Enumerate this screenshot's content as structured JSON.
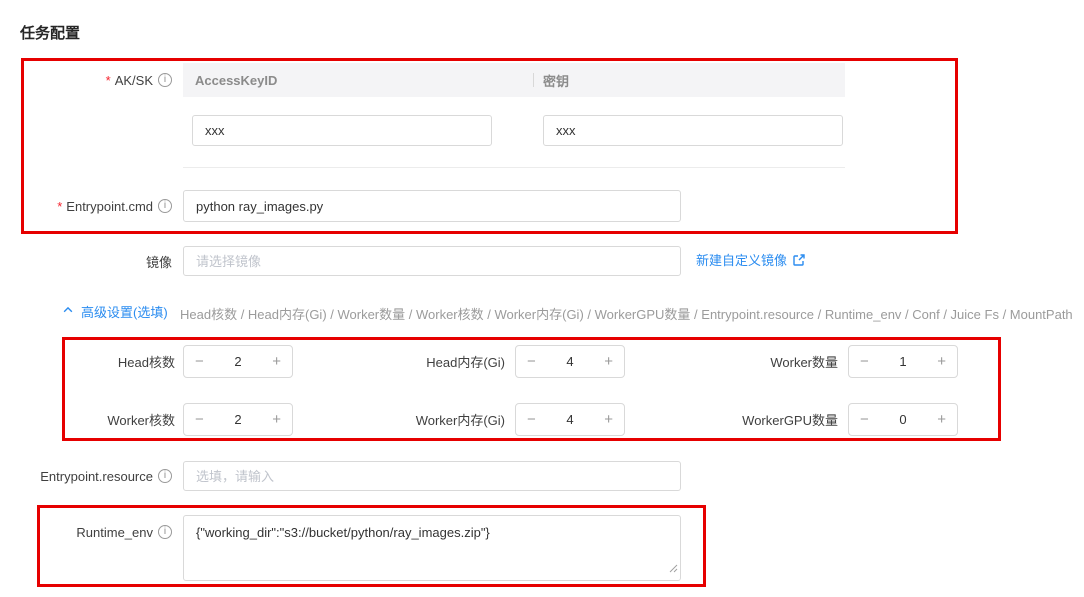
{
  "page": {
    "title": "任务配置"
  },
  "common": {
    "required_mark": "*"
  },
  "icons": {
    "info": "i",
    "minus": "−",
    "plus": "+"
  },
  "colors": {
    "annotation_red": "#e60000",
    "link_blue": "#2a8cf0",
    "header_bg": "#f4f4f6"
  },
  "ak_sk": {
    "label": "AK/SK",
    "access_key_header": "AccessKeyID",
    "secret_header": "密钥",
    "access_key_value": "xxx",
    "secret_value": "xxx"
  },
  "entrypoint_cmd": {
    "label": "Entrypoint.cmd",
    "value": "python ray_images.py"
  },
  "image": {
    "label": "镜像",
    "placeholder": "请选择镜像",
    "create_link_label": "新建自定义镜像"
  },
  "advanced": {
    "toggle_label": "高级设置(选填)",
    "summary": "Head核数 / Head内存(Gi) / Worker数量 / Worker核数 / Worker内存(Gi) / WorkerGPU数量 / Entrypoint.resource / Runtime_env / Conf / Juice Fs / MountPath",
    "steppers": [
      {
        "label": "Head核数",
        "value": "2"
      },
      {
        "label": "Head内存(Gi)",
        "value": "4"
      },
      {
        "label": "Worker数量",
        "value": "1"
      },
      {
        "label": "Worker核数",
        "value": "2"
      },
      {
        "label": "Worker内存(Gi)",
        "value": "4"
      },
      {
        "label": "WorkerGPU数量",
        "value": "0"
      }
    ]
  },
  "entrypoint_resource": {
    "label": "Entrypoint.resource",
    "placeholder": "选填，请输入"
  },
  "runtime_env": {
    "label": "Runtime_env",
    "value": "{\"working_dir\":\"s3://bucket/python/ray_images.zip\"}"
  }
}
